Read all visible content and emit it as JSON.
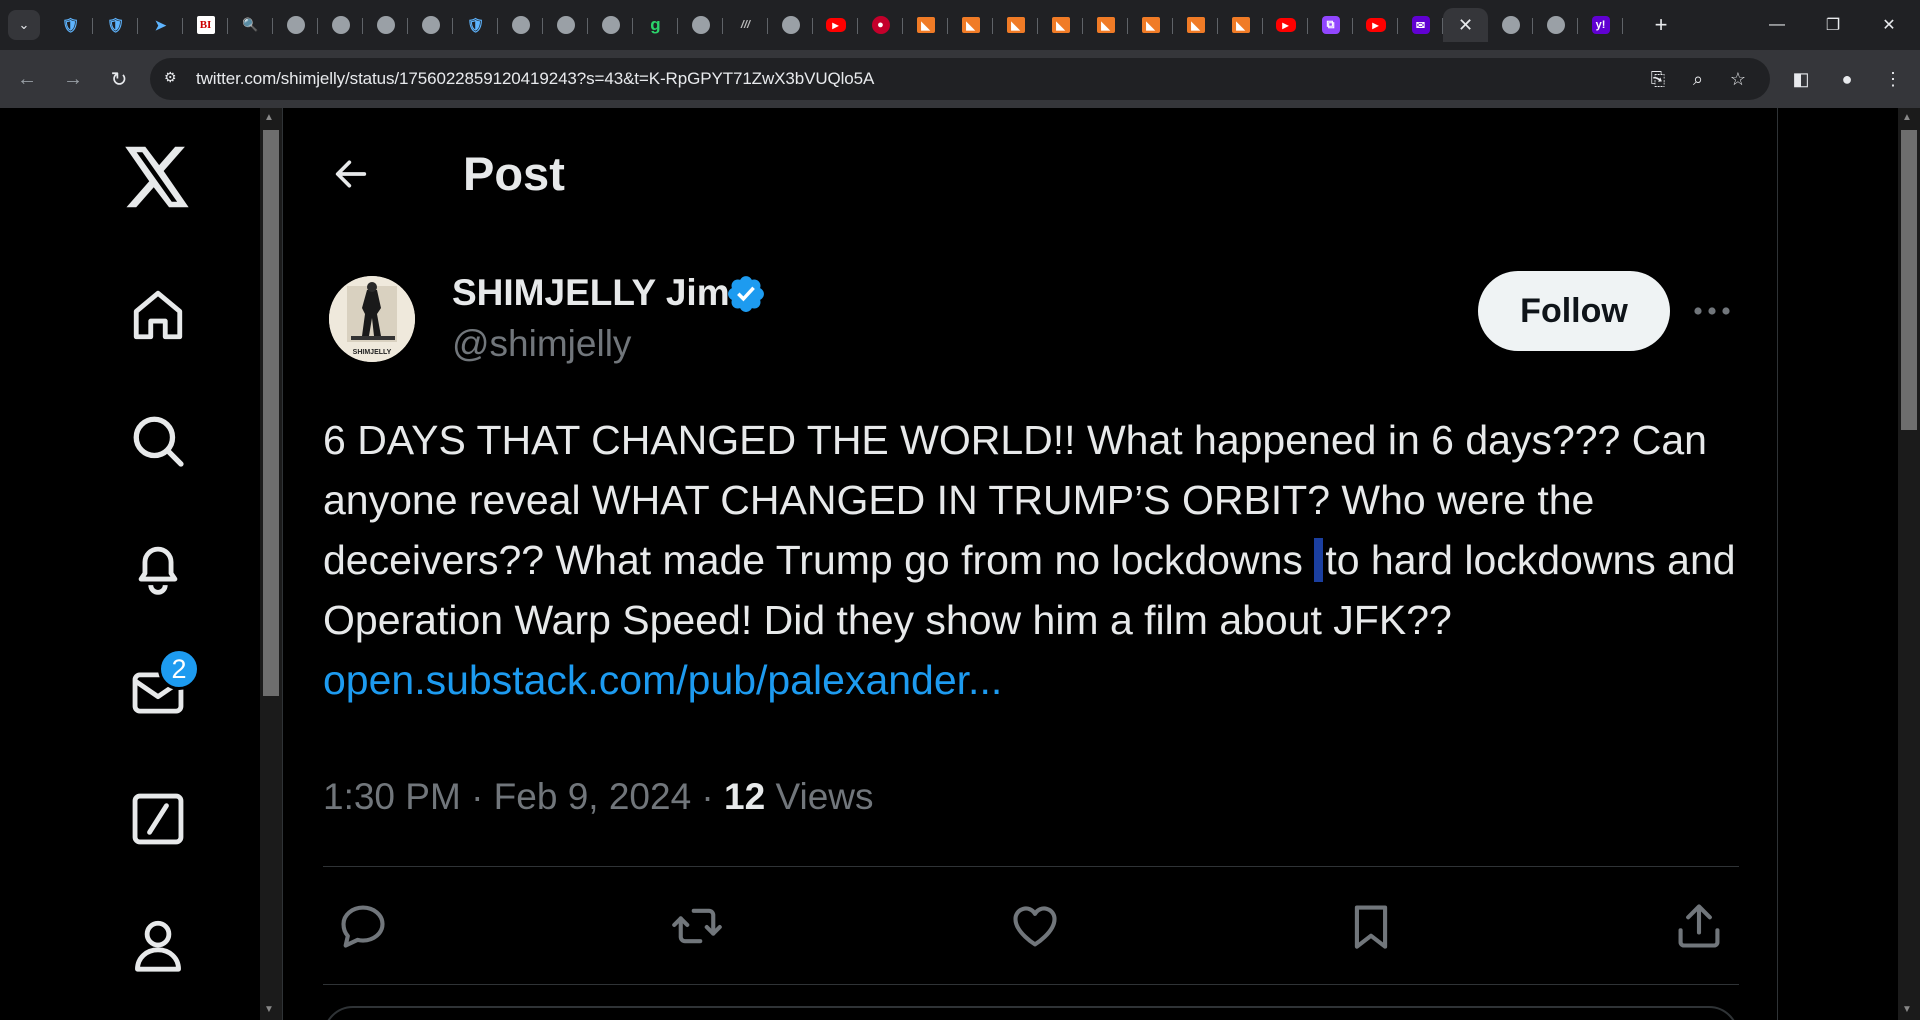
{
  "browser": {
    "tabs": [
      {
        "icon": "shield-icon",
        "glyph": "🛡"
      },
      {
        "icon": "shield-icon",
        "glyph": "🛡"
      },
      {
        "icon": "arrow-app-icon",
        "glyph": "➤"
      },
      {
        "icon": "bi-logo-icon",
        "glyph": "BI"
      },
      {
        "icon": "search-site-icon",
        "glyph": "🔍"
      },
      {
        "icon": "globe-icon",
        "glyph": ""
      },
      {
        "icon": "globe-icon",
        "glyph": ""
      },
      {
        "icon": "globe-icon",
        "glyph": ""
      },
      {
        "icon": "globe-icon",
        "glyph": ""
      },
      {
        "icon": "shield-icon",
        "glyph": "🛡"
      },
      {
        "icon": "globe-icon",
        "glyph": ""
      },
      {
        "icon": "globe-icon",
        "glyph": ""
      },
      {
        "icon": "globe-icon",
        "glyph": ""
      },
      {
        "icon": "g-logo-icon",
        "glyph": "g"
      },
      {
        "icon": "globe-icon",
        "glyph": ""
      },
      {
        "icon": "text-logo-icon",
        "glyph": "///"
      },
      {
        "icon": "globe-icon",
        "glyph": ""
      },
      {
        "icon": "youtube-icon",
        "glyph": "▶"
      },
      {
        "icon": "red-pin-icon",
        "glyph": "●"
      },
      {
        "icon": "bookmark-site-icon",
        "glyph": "◣"
      },
      {
        "icon": "bookmark-site-icon",
        "glyph": "◣"
      },
      {
        "icon": "bookmark-site-icon",
        "glyph": "◣"
      },
      {
        "icon": "bookmark-site-icon",
        "glyph": "◣"
      },
      {
        "icon": "bookmark-site-icon",
        "glyph": "◣"
      },
      {
        "icon": "bookmark-site-icon",
        "glyph": "◣"
      },
      {
        "icon": "bookmark-site-icon",
        "glyph": "◣"
      },
      {
        "icon": "bookmark-site-icon",
        "glyph": "◣"
      },
      {
        "icon": "youtube-icon",
        "glyph": "▶"
      },
      {
        "icon": "twitch-icon",
        "glyph": "⧉"
      },
      {
        "icon": "youtube-icon",
        "glyph": "▶"
      },
      {
        "icon": "mail-icon",
        "glyph": "✉"
      },
      {
        "icon": "close-icon",
        "glyph": "✕",
        "active": true
      },
      {
        "icon": "globe-icon",
        "glyph": ""
      },
      {
        "icon": "globe-icon",
        "glyph": ""
      },
      {
        "icon": "yahoo-icon",
        "glyph": "y!"
      }
    ],
    "new_tab": "+",
    "url": "twitter.com/shimjelly/status/1756022859120419243?s=43&t=K-RpGPYT71ZwX3bVUQlo5A"
  },
  "sidebar": {
    "messages_badge": "2"
  },
  "header": {
    "title": "Post"
  },
  "tweet": {
    "author_name": "SHIMJELLY Jim",
    "author_handle": "@shimjelly",
    "follow_label": "Follow",
    "avatar_caption": "SHIMJELLY",
    "text_before_cursor": "6 DAYS THAT CHANGED THE WORLD!! What happened in 6 days??? Can anyone reveal WHAT CHANGED IN TRUMP’S ORBIT? Who were the deceivers?? What made Trump go from no lockdowns",
    "text_after_cursor": "to hard lockdowns and Operation Warp Speed! Did they show him a film about JFK??",
    "link": "open.substack.com/pub/palexander...",
    "timestamp": "1:30 PM · Feb 9, 2024 · ",
    "views_count": "12",
    "views_label": " Views"
  },
  "colors": {
    "accent": "#1d9bf0",
    "background": "#000000",
    "text": "#e7e9ea",
    "muted": "#71767b",
    "divider": "#2f3336"
  }
}
